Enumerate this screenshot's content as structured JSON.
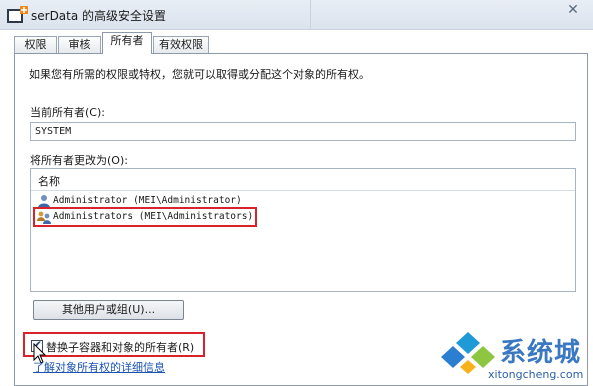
{
  "window": {
    "title": "serData 的高级安全设置",
    "close_symbol": "✕"
  },
  "tabs": [
    {
      "label": "权限"
    },
    {
      "label": "审核"
    },
    {
      "label": "所有者"
    },
    {
      "label": "有效权限"
    }
  ],
  "owner_tab": {
    "description": "如果您有所需的权限或特权，您就可以取得或分配这个对象的所有权。",
    "current_owner_label": "当前所有者(C):",
    "current_owner_value": "SYSTEM",
    "change_to_label": "将所有者更改为(O):",
    "list": {
      "column_header": "名称",
      "items": [
        {
          "icon": "user-icon",
          "text": "Administrator (MEI\\Administrator)"
        },
        {
          "icon": "group-icon",
          "text": "Administrators (MEI\\Administrators)"
        }
      ]
    },
    "other_users_button": "其他用户或组(U)...",
    "replace_checkbox": {
      "label": "替换子容器和对象的所有者(R)",
      "checked": true
    },
    "details_link": "了解对象所有权的详细信息"
  },
  "watermark": {
    "name": "系统城",
    "url": "xitongcheng.com"
  },
  "colors": {
    "highlight_border": "#d9232b",
    "link": "#1a53b0",
    "watermark_blue": "#3a78c2"
  }
}
